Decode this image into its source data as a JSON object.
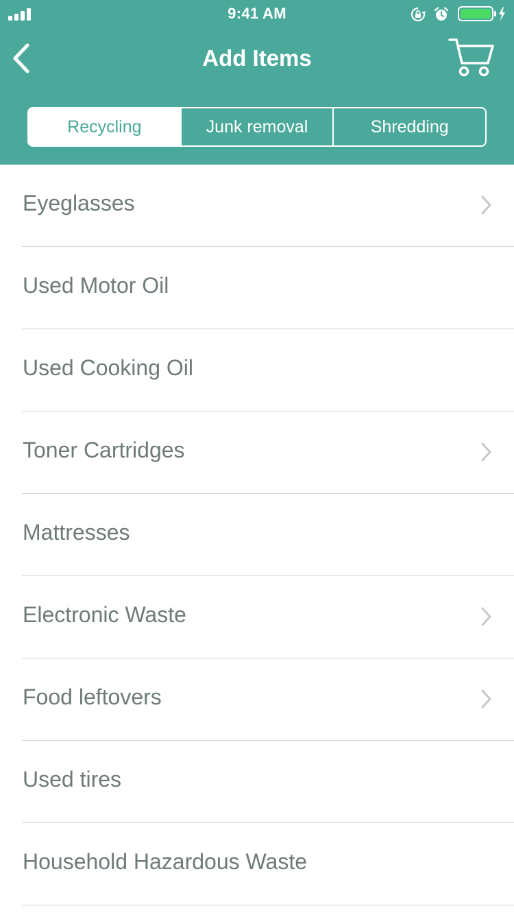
{
  "status_bar": {
    "time": "9:41 AM",
    "signal_icon": "cellular-signal-icon",
    "lock_icon": "orientation-lock-icon",
    "alarm_icon": "alarm-icon",
    "battery_icon": "battery-charging-icon",
    "battery_color": "#4cd964"
  },
  "nav": {
    "title": "Add Items",
    "back_icon": "chevron-left-icon",
    "cart_icon": "shopping-cart-icon"
  },
  "tabs": [
    {
      "label": "Recycling",
      "active": true
    },
    {
      "label": "Junk removal",
      "active": false
    },
    {
      "label": "Shredding",
      "active": false
    }
  ],
  "items": [
    {
      "label": "Eyeglasses",
      "has_chevron": true
    },
    {
      "label": "Used Motor Oil",
      "has_chevron": false
    },
    {
      "label": "Used Cooking Oil",
      "has_chevron": false
    },
    {
      "label": "Toner Cartridges",
      "has_chevron": true
    },
    {
      "label": "Mattresses",
      "has_chevron": false
    },
    {
      "label": "Electronic Waste",
      "has_chevron": true
    },
    {
      "label": "Food leftovers",
      "has_chevron": true
    },
    {
      "label": "Used tires",
      "has_chevron": false
    },
    {
      "label": "Household Hazardous Waste",
      "has_chevron": false
    }
  ],
  "colors": {
    "header_background": "#4aa99a",
    "item_text": "#6f7b78",
    "chevron": "#c7c7cc",
    "separator": "#d6d6d6"
  }
}
